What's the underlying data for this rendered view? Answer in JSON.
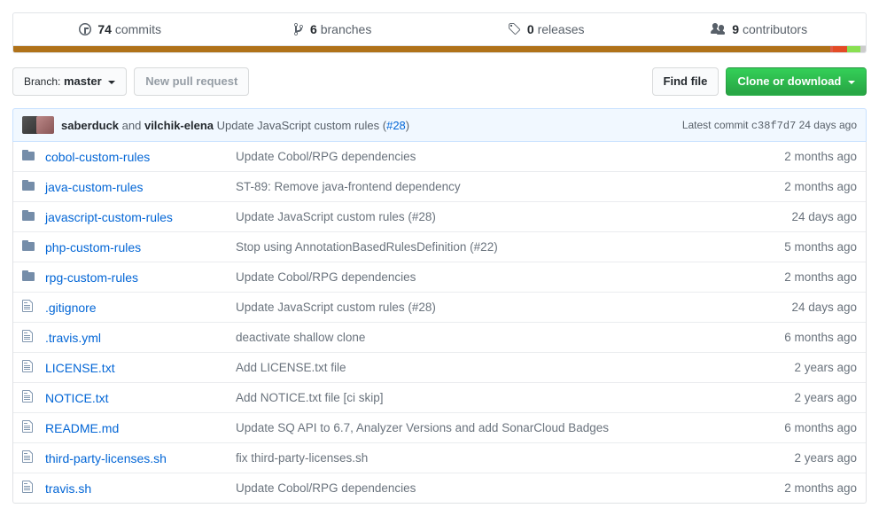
{
  "stats": {
    "commits": {
      "count": "74",
      "label": "commits"
    },
    "branches": {
      "count": "6",
      "label": "branches"
    },
    "releases": {
      "count": "0",
      "label": "releases"
    },
    "contributors": {
      "count": "9",
      "label": "contributors"
    }
  },
  "languages": [
    {
      "color": "#b07219",
      "percent": 95.8
    },
    {
      "color": "#e05a47",
      "percent": 0.4
    },
    {
      "color": "#e34c26",
      "percent": 1.6
    },
    {
      "color": "#89e051",
      "percent": 1.6
    },
    {
      "color": "#ccc",
      "percent": 0.6
    }
  ],
  "branch": {
    "label": "Branch:",
    "value": "master"
  },
  "buttons": {
    "new_pr": "New pull request",
    "find_file": "Find file",
    "clone": "Clone or download"
  },
  "latest_commit": {
    "authors_html_pre": "saberduck",
    "authors_and": " and ",
    "authors_html_post": "vilchik-elena",
    "message": " Update JavaScript custom rules (",
    "pr": "#28",
    "message_suffix": ")",
    "meta_label": "Latest commit ",
    "sha": "c38f7d7",
    "age": " 24 days ago"
  },
  "files": [
    {
      "type": "dir",
      "name": "cobol-custom-rules",
      "message": "Update Cobol/RPG dependencies",
      "age": "2 months ago"
    },
    {
      "type": "dir",
      "name": "java-custom-rules",
      "message": "ST-89: Remove java-frontend dependency",
      "age": "2 months ago"
    },
    {
      "type": "dir",
      "name": "javascript-custom-rules",
      "message": "Update JavaScript custom rules (#28)",
      "age": "24 days ago"
    },
    {
      "type": "dir",
      "name": "php-custom-rules",
      "message": "Stop using AnnotationBasedRulesDefinition (#22)",
      "age": "5 months ago"
    },
    {
      "type": "dir",
      "name": "rpg-custom-rules",
      "message": "Update Cobol/RPG dependencies",
      "age": "2 months ago"
    },
    {
      "type": "file",
      "name": ".gitignore",
      "message": "Update JavaScript custom rules (#28)",
      "age": "24 days ago"
    },
    {
      "type": "file",
      "name": ".travis.yml",
      "message": "deactivate shallow clone",
      "age": "6 months ago"
    },
    {
      "type": "file",
      "name": "LICENSE.txt",
      "message": "Add LICENSE.txt file",
      "age": "2 years ago"
    },
    {
      "type": "file",
      "name": "NOTICE.txt",
      "message": "Add NOTICE.txt file [ci skip]",
      "age": "2 years ago"
    },
    {
      "type": "file",
      "name": "README.md",
      "message": "Update SQ API to 6.7, Analyzer Versions and add SonarCloud Badges",
      "age": "6 months ago"
    },
    {
      "type": "file",
      "name": "third-party-licenses.sh",
      "message": "fix third-party-licenses.sh",
      "age": "2 years ago"
    },
    {
      "type": "file",
      "name": "travis.sh",
      "message": "Update Cobol/RPG dependencies",
      "age": "2 months ago"
    }
  ]
}
